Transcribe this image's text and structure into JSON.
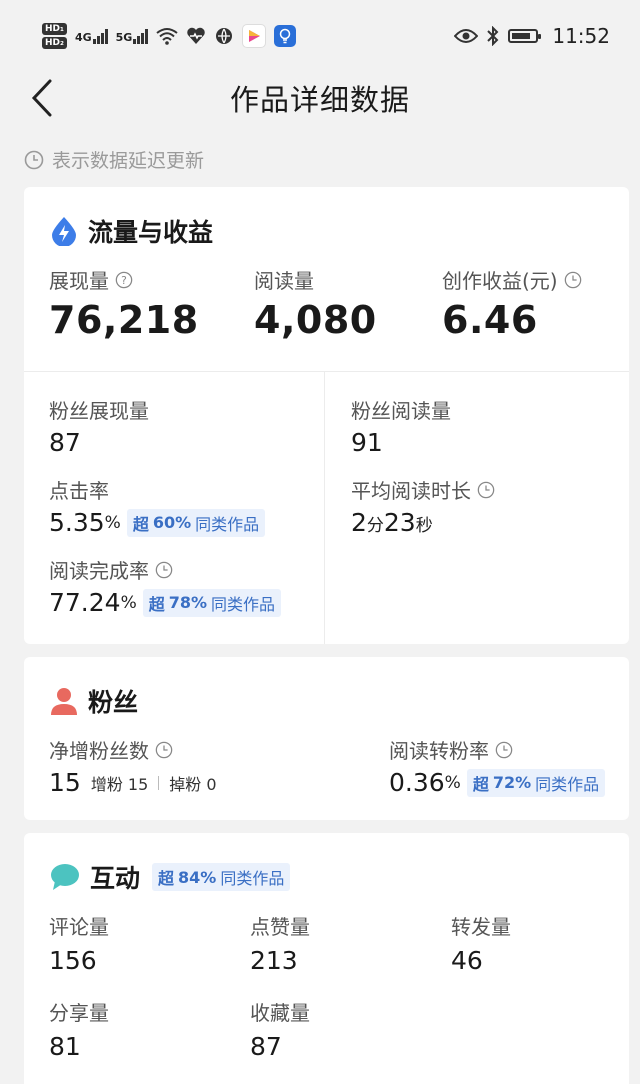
{
  "status_bar": {
    "hd1": "HD₁",
    "hd2": "HD₂",
    "net1": "4G",
    "net2": "5G",
    "time": "11:52"
  },
  "header": {
    "title": "作品详细数据"
  },
  "delay_note": "表示数据延迟更新",
  "traffic": {
    "title": "流量与收益",
    "impressions_label": "展现量",
    "impressions_value": "76,218",
    "reads_label": "阅读量",
    "reads_value": "4,080",
    "earnings_label": "创作收益(元)",
    "earnings_value": "6.46",
    "fan_impressions_label": "粉丝展现量",
    "fan_impressions_value": "87",
    "fan_reads_label": "粉丝阅读量",
    "fan_reads_value": "91",
    "ctr_label": "点击率",
    "ctr_value": "5.35",
    "ctr_unit": "%",
    "ctr_badge_prefix": "超",
    "ctr_badge_pct": "60%",
    "ctr_badge_suffix": "同类作品",
    "avg_time_label": "平均阅读时长",
    "avg_time_min": "2",
    "avg_time_min_unit": "分",
    "avg_time_sec": "23",
    "avg_time_sec_unit": "秒",
    "completion_label": "阅读完成率",
    "completion_value": "77.24",
    "completion_unit": "%",
    "completion_badge_prefix": "超",
    "completion_badge_pct": "78%",
    "completion_badge_suffix": "同类作品"
  },
  "fans": {
    "title": "粉丝",
    "net_label": "净增粉丝数",
    "net_value": "15",
    "gain_label": "增粉",
    "gain_value": "15",
    "loss_label": "掉粉",
    "loss_value": "0",
    "conv_label": "阅读转粉率",
    "conv_value": "0.36",
    "conv_unit": "%",
    "conv_badge_prefix": "超",
    "conv_badge_pct": "72%",
    "conv_badge_suffix": "同类作品"
  },
  "interaction": {
    "title": "互动",
    "badge_prefix": "超",
    "badge_pct": "84%",
    "badge_suffix": "同类作品",
    "comments_label": "评论量",
    "comments_value": "156",
    "likes_label": "点赞量",
    "likes_value": "213",
    "reposts_label": "转发量",
    "reposts_value": "46",
    "shares_label": "分享量",
    "shares_value": "81",
    "favorites_label": "收藏量",
    "favorites_value": "87"
  },
  "colors": {
    "accent_blue": "#3a6fc4",
    "badge_bg": "#eaf1fc",
    "fans_icon": "#e8695f",
    "interaction_icon": "#4cc3c0",
    "traffic_icon": "#3d7de8"
  }
}
